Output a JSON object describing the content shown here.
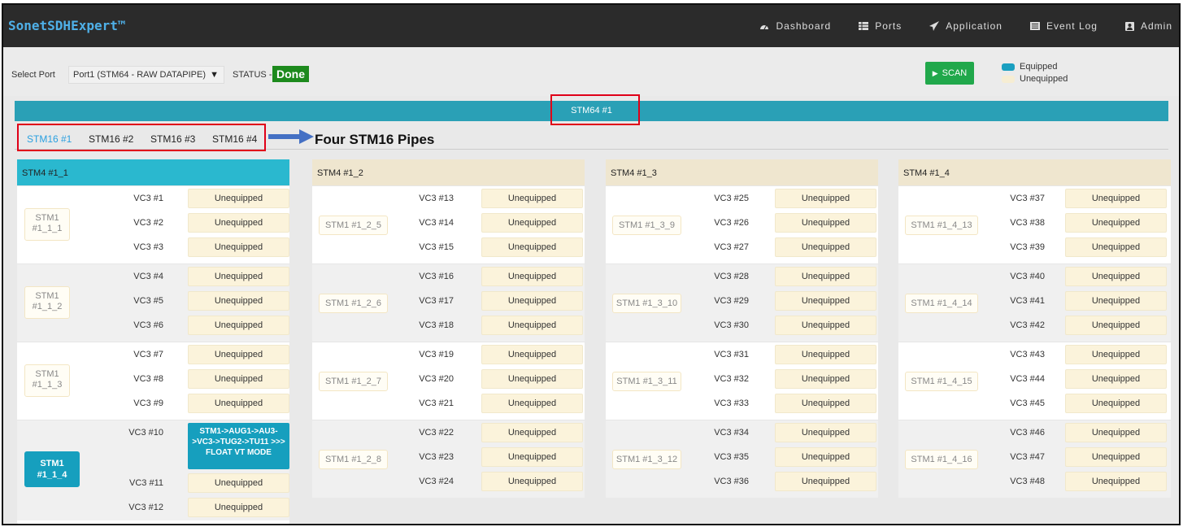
{
  "app": {
    "title": "SonetSDHExpert™"
  },
  "nav": [
    {
      "label": "Dashboard",
      "icon": "dashboard-icon"
    },
    {
      "label": "Ports",
      "icon": "ports-icon"
    },
    {
      "label": "Application",
      "icon": "paper-plane-icon"
    },
    {
      "label": "Event Log",
      "icon": "list-icon"
    },
    {
      "label": "Admin",
      "icon": "user-icon"
    }
  ],
  "toolbar": {
    "select_port_label": "Select Port",
    "port_value": "Port1 (STM64 - RAW DATAPIPE)",
    "status_label": "STATUS -",
    "status_value": "Done",
    "scan_label": "SCAN"
  },
  "legend": [
    {
      "label": "Equipped",
      "color": "#1a9fc0"
    },
    {
      "label": "Unequipped",
      "color": "#f6edd3"
    }
  ],
  "banner": "STM64 #1",
  "tabs": [
    "STM16 #1",
    "STM16 #2",
    "STM16 #3",
    "STM16 #4"
  ],
  "annotation": "Four STM16 Pipes",
  "colors": {
    "equipped": "#169fbe",
    "unequipped": "#fbf3db",
    "card_header_active": "#2ab8cf",
    "card_header": "#efe6cf",
    "scan": "#21a84b",
    "status_done": "#1d8a1d"
  },
  "cards": [
    {
      "title": "STM4 #1_1",
      "groups": [
        {
          "stm1": "STM1 #1_1_1",
          "vcs": [
            {
              "vc": "VC3 #1",
              "status": "Unequipped"
            },
            {
              "vc": "VC3 #2",
              "status": "Unequipped"
            },
            {
              "vc": "VC3 #3",
              "status": "Unequipped"
            }
          ]
        },
        {
          "stm1": "STM1 #1_1_2",
          "vcs": [
            {
              "vc": "VC3 #4",
              "status": "Unequipped"
            },
            {
              "vc": "VC3 #5",
              "status": "Unequipped"
            },
            {
              "vc": "VC3 #6",
              "status": "Unequipped"
            }
          ]
        },
        {
          "stm1": "STM1 #1_1_3",
          "vcs": [
            {
              "vc": "VC3 #7",
              "status": "Unequipped"
            },
            {
              "vc": "VC3 #8",
              "status": "Unequipped"
            },
            {
              "vc": "VC3 #9",
              "status": "Unequipped"
            }
          ]
        },
        {
          "stm1": "STM1 #1_1_4",
          "vcs": [
            {
              "vc": "VC3 #10",
              "status": "STM1->AUG1->AU3->VC3->TUG2->TU11 >>> FLOAT VT MODE"
            },
            {
              "vc": "VC3 #11",
              "status": "Unequipped"
            },
            {
              "vc": "VC3 #12",
              "status": "Unequipped"
            }
          ]
        }
      ]
    },
    {
      "title": "STM4 #1_2",
      "groups": [
        {
          "stm1": "STM1 #1_2_5",
          "vcs": [
            {
              "vc": "VC3 #13",
              "status": "Unequipped"
            },
            {
              "vc": "VC3 #14",
              "status": "Unequipped"
            },
            {
              "vc": "VC3 #15",
              "status": "Unequipped"
            }
          ]
        },
        {
          "stm1": "STM1 #1_2_6",
          "vcs": [
            {
              "vc": "VC3 #16",
              "status": "Unequipped"
            },
            {
              "vc": "VC3 #17",
              "status": "Unequipped"
            },
            {
              "vc": "VC3 #18",
              "status": "Unequipped"
            }
          ]
        },
        {
          "stm1": "STM1 #1_2_7",
          "vcs": [
            {
              "vc": "VC3 #19",
              "status": "Unequipped"
            },
            {
              "vc": "VC3 #20",
              "status": "Unequipped"
            },
            {
              "vc": "VC3 #21",
              "status": "Unequipped"
            }
          ]
        },
        {
          "stm1": "STM1 #1_2_8",
          "vcs": [
            {
              "vc": "VC3 #22",
              "status": "Unequipped"
            },
            {
              "vc": "VC3 #23",
              "status": "Unequipped"
            },
            {
              "vc": "VC3 #24",
              "status": "Unequipped"
            }
          ]
        }
      ]
    },
    {
      "title": "STM4 #1_3",
      "groups": [
        {
          "stm1": "STM1 #1_3_9",
          "vcs": [
            {
              "vc": "VC3 #25",
              "status": "Unequipped"
            },
            {
              "vc": "VC3 #26",
              "status": "Unequipped"
            },
            {
              "vc": "VC3 #27",
              "status": "Unequipped"
            }
          ]
        },
        {
          "stm1": "STM1 #1_3_10",
          "vcs": [
            {
              "vc": "VC3 #28",
              "status": "Unequipped"
            },
            {
              "vc": "VC3 #29",
              "status": "Unequipped"
            },
            {
              "vc": "VC3 #30",
              "status": "Unequipped"
            }
          ]
        },
        {
          "stm1": "STM1 #1_3_11",
          "vcs": [
            {
              "vc": "VC3 #31",
              "status": "Unequipped"
            },
            {
              "vc": "VC3 #32",
              "status": "Unequipped"
            },
            {
              "vc": "VC3 #33",
              "status": "Unequipped"
            }
          ]
        },
        {
          "stm1": "STM1 #1_3_12",
          "vcs": [
            {
              "vc": "VC3 #34",
              "status": "Unequipped"
            },
            {
              "vc": "VC3 #35",
              "status": "Unequipped"
            },
            {
              "vc": "VC3 #36",
              "status": "Unequipped"
            }
          ]
        }
      ]
    },
    {
      "title": "STM4 #1_4",
      "groups": [
        {
          "stm1": "STM1 #1_4_13",
          "vcs": [
            {
              "vc": "VC3 #37",
              "status": "Unequipped"
            },
            {
              "vc": "VC3 #38",
              "status": "Unequipped"
            },
            {
              "vc": "VC3 #39",
              "status": "Unequipped"
            }
          ]
        },
        {
          "stm1": "STM1 #1_4_14",
          "vcs": [
            {
              "vc": "VC3 #40",
              "status": "Unequipped"
            },
            {
              "vc": "VC3 #41",
              "status": "Unequipped"
            },
            {
              "vc": "VC3 #42",
              "status": "Unequipped"
            }
          ]
        },
        {
          "stm1": "STM1 #1_4_15",
          "vcs": [
            {
              "vc": "VC3 #43",
              "status": "Unequipped"
            },
            {
              "vc": "VC3 #44",
              "status": "Unequipped"
            },
            {
              "vc": "VC3 #45",
              "status": "Unequipped"
            }
          ]
        },
        {
          "stm1": "STM1 #1_4_16",
          "vcs": [
            {
              "vc": "VC3 #46",
              "status": "Unequipped"
            },
            {
              "vc": "VC3 #47",
              "status": "Unequipped"
            },
            {
              "vc": "VC3 #48",
              "status": "Unequipped"
            }
          ]
        }
      ]
    }
  ]
}
